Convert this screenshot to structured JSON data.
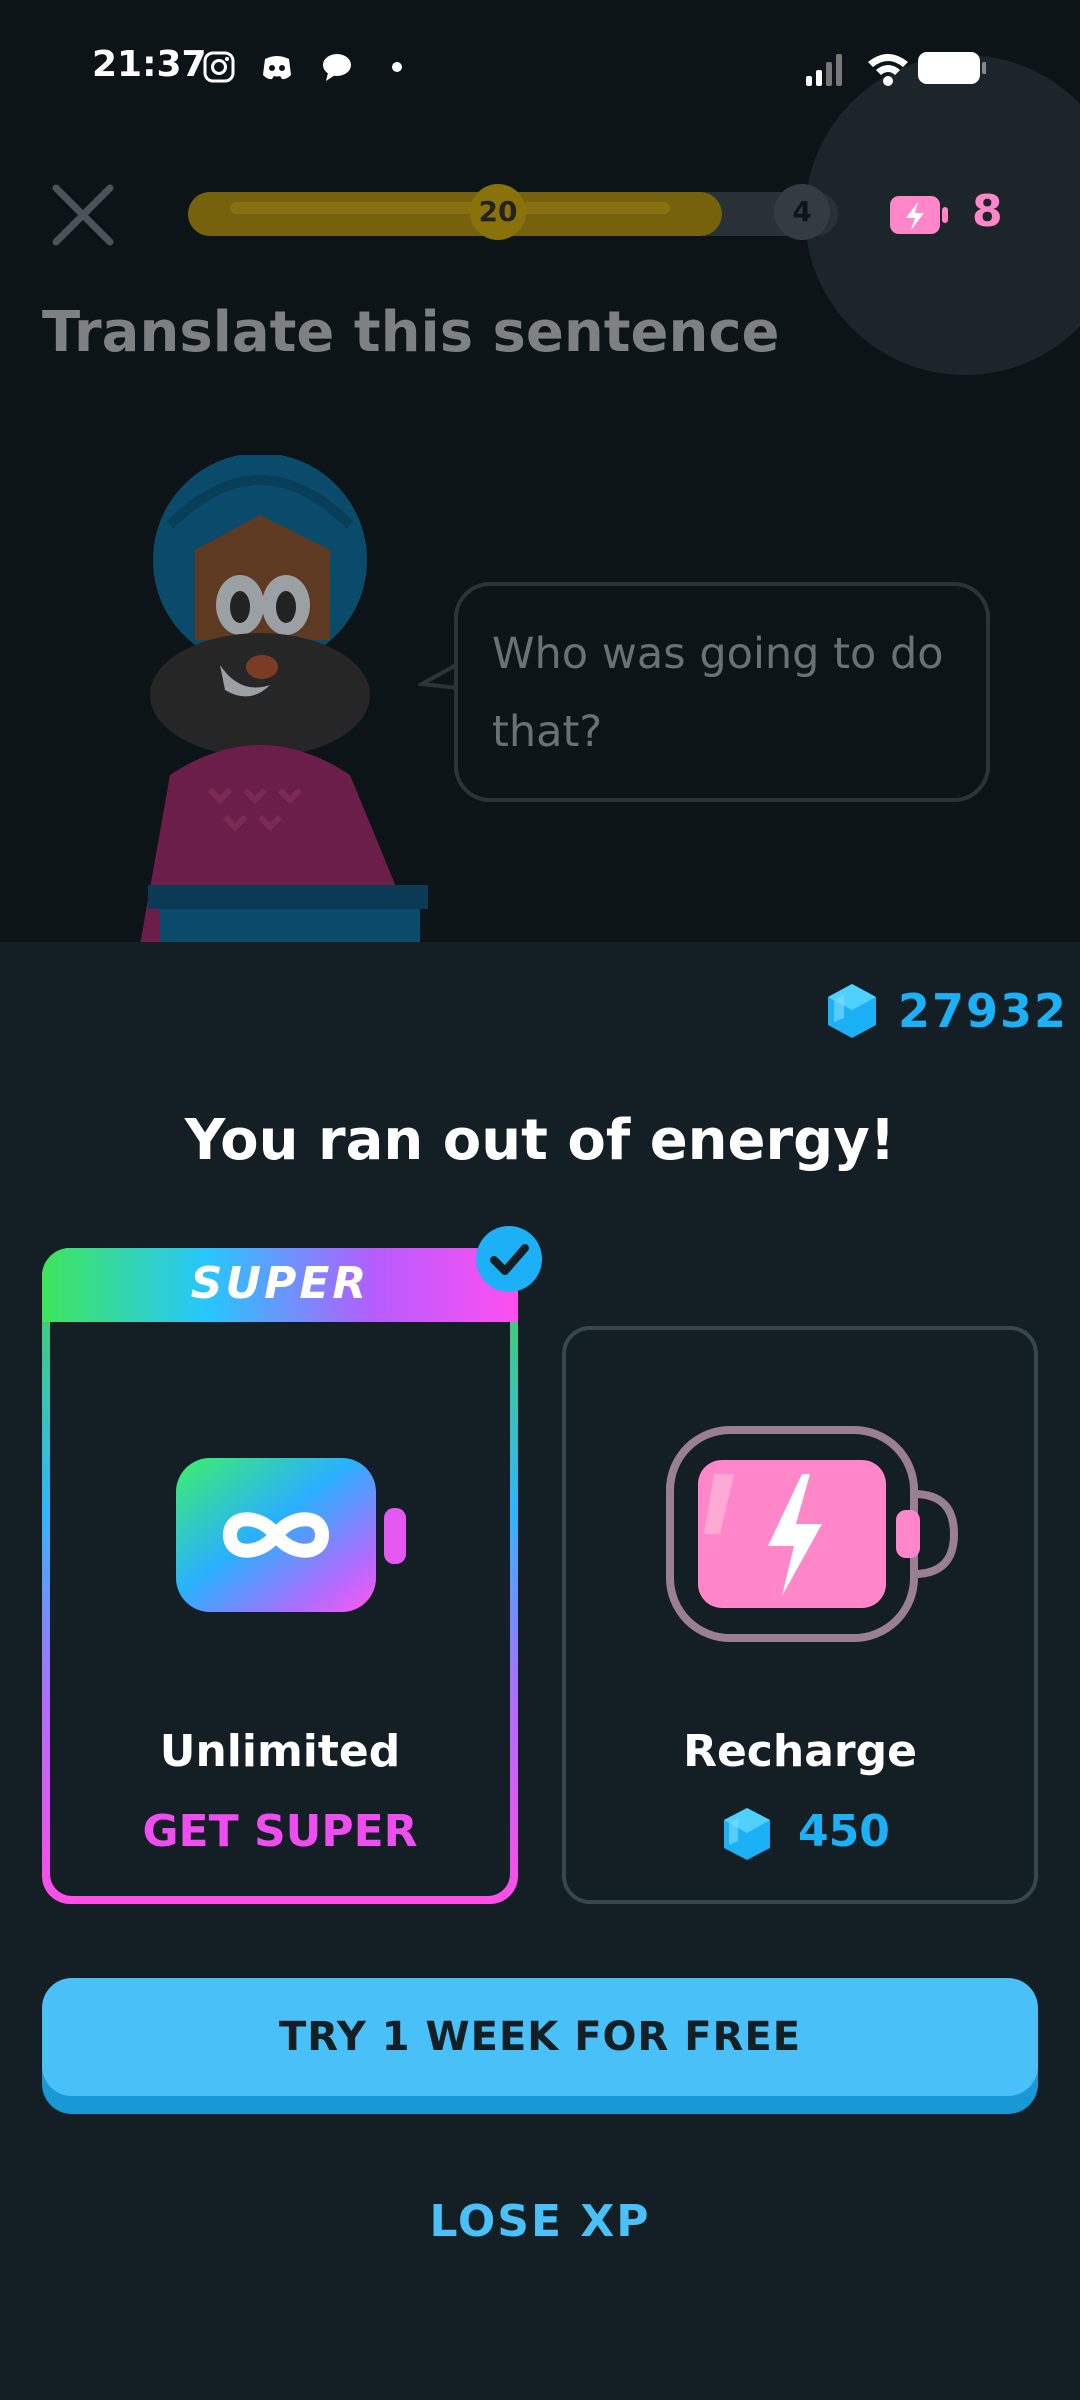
{
  "status_bar": {
    "time": "21:37",
    "icons": [
      "instagram-icon",
      "discord-icon",
      "chat-icon",
      "dot-icon"
    ],
    "right_icons": [
      "signal-icon",
      "wifi-icon",
      "battery-icon"
    ]
  },
  "lesson": {
    "progress_percent": 78,
    "milestone_current": "20",
    "milestone_next": "4",
    "energy_count": "8",
    "prompt_title": "Translate this sentence",
    "speech": "Who was going to do that?"
  },
  "sheet": {
    "gems": "27932",
    "title": "You ran out of energy!",
    "super_card": {
      "banner": "SUPER",
      "label": "Unlimited",
      "cta": "GET SUPER",
      "selected": true
    },
    "recharge_card": {
      "label": "Recharge",
      "cost": "450"
    },
    "primary_button": "TRY 1 WEEK FOR FREE",
    "secondary_button": "LOSE XP"
  },
  "colors": {
    "gem_blue": "#1cb0f6",
    "energy_pink": "#ff86c9",
    "super_pink": "#f04df0",
    "button_blue": "#49c0f8"
  }
}
